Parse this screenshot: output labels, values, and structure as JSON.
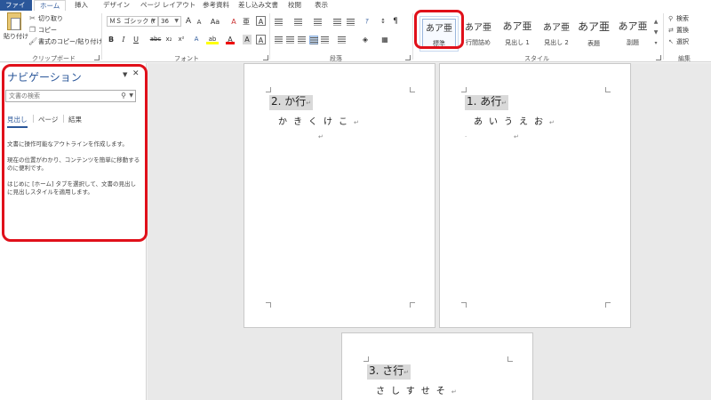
{
  "ribbon_tabs": [
    "ファイル",
    "ホーム",
    "挿入",
    "デザイン",
    "ページ レイアウト",
    "参考資料",
    "差し込み文書",
    "校閲",
    "表示"
  ],
  "clipboard": {
    "paste_label": "貼り付け",
    "cut": "切り取り",
    "copy": "コピー",
    "format_painter": "書式のコピー/貼り付け",
    "group_label": "クリップボード"
  },
  "font": {
    "name": "ＭＳ ゴシック (.",
    "size": "36",
    "group_label": "フォント",
    "grow_label": "A",
    "shrink_label": "A",
    "case_label": "Aa",
    "clear_label": "A",
    "phonetic_label": "亜",
    "enclose_label": "A",
    "bold": "B",
    "italic": "I",
    "underline": "U",
    "strike": "abc",
    "subscript": "x₂",
    "superscript": "x²",
    "highlight_color_label": "ab",
    "font_color_label": "A",
    "shading_label": "A",
    "border_label": "A"
  },
  "paragraph": {
    "group_label": "段落"
  },
  "styles": {
    "group_label": "スタイル",
    "items": [
      {
        "preview": "あア亜",
        "name": "標準"
      },
      {
        "preview": "あア亜",
        "name": "行間詰め"
      },
      {
        "preview": "あア亜",
        "name": "見出し 1"
      },
      {
        "preview": "あア亜",
        "name": "見出し 2"
      },
      {
        "preview": "あア亜",
        "name": "表題"
      },
      {
        "preview": "あア亜",
        "name": "副題"
      }
    ]
  },
  "editing": {
    "group_label": "編集",
    "find": "検索",
    "replace": "置換",
    "select": "選択"
  },
  "navigation": {
    "title": "ナビゲーション",
    "search_placeholder": "文書の検索",
    "tabs": [
      "見出し",
      "ページ",
      "結果"
    ],
    "text1": "文書に操作可能なアウトラインを作成します。",
    "text2": "現在の位置がわかり、コンテンツを簡単に移動するのに便利です。",
    "text3": "はじめに [ホーム] タブを選択して、文書の見出しに見出しスタイルを適用します。"
  },
  "pages": [
    {
      "heading": "2. か行",
      "body": "かきくけこ"
    },
    {
      "heading": "1. あ行",
      "body": "あいうえお"
    },
    {
      "heading": "3. さ行",
      "body": "さしすせそ"
    }
  ],
  "colors": {
    "file_tab": "#2b579a",
    "highlight_red": "#e0101a"
  }
}
